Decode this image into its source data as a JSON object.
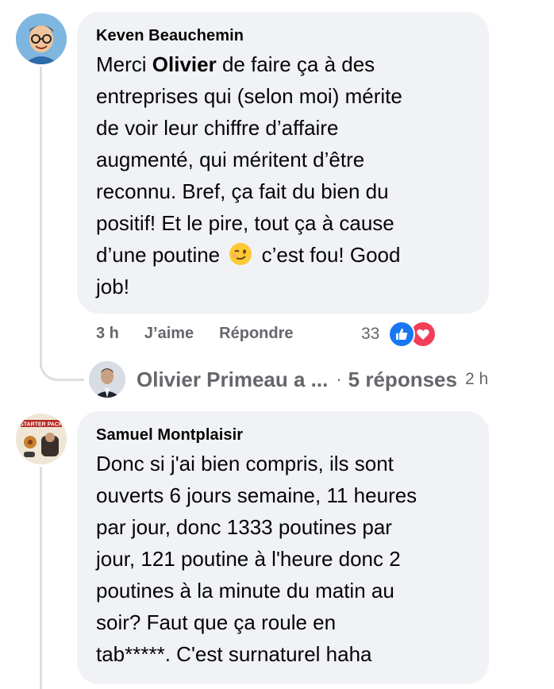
{
  "comments": [
    {
      "author": "Keven Beauchemin",
      "text_before_mention": "Merci ",
      "mention": "Olivier",
      "text_line_1_rest": " de faire ça à des",
      "text_lines": [
        "entreprises qui (selon moi) mérite",
        "de voir leur chiffre d’affaire",
        "augmenté, qui méritent d’être",
        "reconnu. Bref, ça fait du bien du",
        "positif! Et le pire, tout ça à cause"
      ],
      "text_emoji_line_before": "d’une poutine ",
      "emoji": "winking-face",
      "text_emoji_line_after": " c’est fou! Good",
      "text_last_line": "job!",
      "time": "3 h",
      "like_label": "J’aime",
      "reply_label": "Répondre",
      "reaction_count": "33",
      "reactions": [
        "like",
        "love"
      ]
    },
    {
      "author": "Samuel Montplaisir",
      "text_lines": [
        "Donc si j'ai bien compris, ils sont",
        "ouverts 6 jours semaine, 11 heures",
        "par jour, donc 1333 poutines par",
        "jour, 121 poutine à l'heure donc 2",
        "poutines à la minute du matin au",
        "soir? Faut que ça roule en",
        "tab*****. C'est surnaturel haha"
      ]
    }
  ],
  "replies_summary": {
    "name": "Olivier Primeau a ...",
    "separator": "·",
    "count_label": "5 réponses",
    "time": "2 h"
  },
  "colors": {
    "bubble": "#f0f2f5",
    "secondary_text": "#65676b",
    "like_blue": "#1877f2",
    "love_red": "#f33e58",
    "thread_line": "#dcdee3"
  }
}
